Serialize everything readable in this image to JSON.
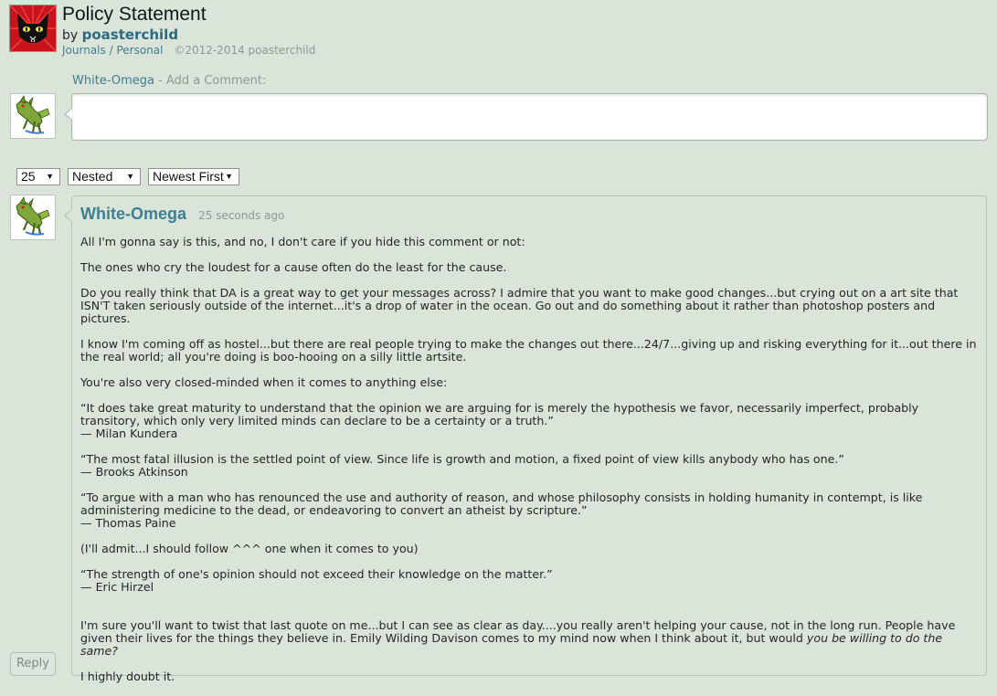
{
  "header": {
    "title": "Policy Statement",
    "by_prefix": "by",
    "author": "poasterchild",
    "crumb_journals": "Journals",
    "crumb_sep": "/",
    "crumb_personal": "Personal",
    "copyright": "©2012-2014 poasterchild"
  },
  "add_comment": {
    "username": "White-Omega",
    "label_suffix": " - Add a Comment:",
    "value": ""
  },
  "controls": {
    "per_page": "25",
    "view_mode": "Nested",
    "sort_order": "Newest First"
  },
  "comment": {
    "author": "White-Omega",
    "time": "25 seconds ago",
    "paragraphs": [
      "All I'm gonna say is this, and no, I don't care if you hide this comment or not:",
      "The ones who cry the loudest for a cause often do the least for the cause.",
      "Do you really think that DA is a great way to get your messages across?  I admire that you want to make good changes...but crying out on a art site that ISN'T taken seriously outside of the internet...it's a drop of water in the ocean.   Go out and do something about it rather than photoshop posters and pictures.",
      "I know I'm coming off as hostel...but there are real people trying to make the changes out there...24/7...giving up and risking everything for it...out there in the real world; all you're doing is boo-hooing on a silly little artsite.",
      "You're also very closed-minded when it comes to anything else:",
      "“It does take great maturity to understand that the opinion we are arguing for is merely the hypothesis we favor, necessarily imperfect, probably transitory, which only very limited minds can declare to be a certainty or a truth.”\n— Milan Kundera",
      "“The most fatal illusion is the settled point of view. Since life is growth and motion, a fixed point of view kills anybody who has one.”\n— Brooks Atkinson",
      "“To argue with a man who has renounced the use and authority of reason, and whose philosophy consists in holding humanity in contempt, is like administering medicine to the dead, or endeavoring to convert an atheist by scripture.”\n— Thomas Paine",
      "(I'll admit...I should follow ^^^ one when it comes to you)",
      "“The strength of one's opinion should not exceed their knowledge on the matter.”\n— Eric Hirzel"
    ],
    "closing_text": "I'm sure you'll want to twist that last quote on me...but I can see as clear as day....you really aren't helping your cause, not in the long run.  People have given their lives for the things they believe in.  Emily Wilding Davison comes to my mind now when I think about it, but would ",
    "closing_italic": "you be willing to do the same?",
    "final_line": "I highly doubt it.",
    "reply_label": "Reply"
  },
  "colors": {
    "background": "#dae4d9",
    "link": "#3e7f90",
    "muted": "#8b9b93"
  }
}
